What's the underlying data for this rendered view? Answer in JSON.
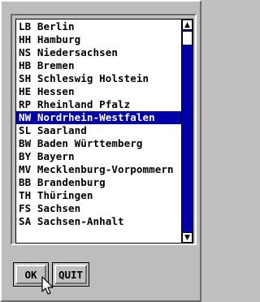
{
  "list": {
    "items": [
      {
        "code": "LB",
        "name": "Berlin"
      },
      {
        "code": "HH",
        "name": "Hamburg"
      },
      {
        "code": "NS",
        "name": "Niedersachsen"
      },
      {
        "code": "HB",
        "name": "Bremen"
      },
      {
        "code": "SH",
        "name": "Schleswig Holstein"
      },
      {
        "code": "HE",
        "name": "Hessen"
      },
      {
        "code": "RP",
        "name": "Rheinland Pfalz"
      },
      {
        "code": "NW",
        "name": "Nordrhein-Westfalen"
      },
      {
        "code": "SL",
        "name": "Saarland"
      },
      {
        "code": "BW",
        "name": "Baden Württemberg"
      },
      {
        "code": "BY",
        "name": "Bayern"
      },
      {
        "code": "MV",
        "name": "Mecklenburg-Vorpommern"
      },
      {
        "code": "BB",
        "name": "Brandenburg"
      },
      {
        "code": "TH",
        "name": "Thüringen"
      },
      {
        "code": "FS",
        "name": "Sachsen"
      },
      {
        "code": "SA",
        "name": "Sachsen-Anhalt"
      }
    ],
    "selected_index": 7
  },
  "buttons": {
    "ok_label": "OK",
    "quit_label": "QUIT"
  },
  "scrollbar": {
    "up_icon": "arrow-up-icon",
    "down_icon": "arrow-down-icon"
  },
  "colors": {
    "selection": "#0000a8",
    "scrollbar_track": "#0000a8",
    "dialog_bg": "#bdbdbd"
  }
}
